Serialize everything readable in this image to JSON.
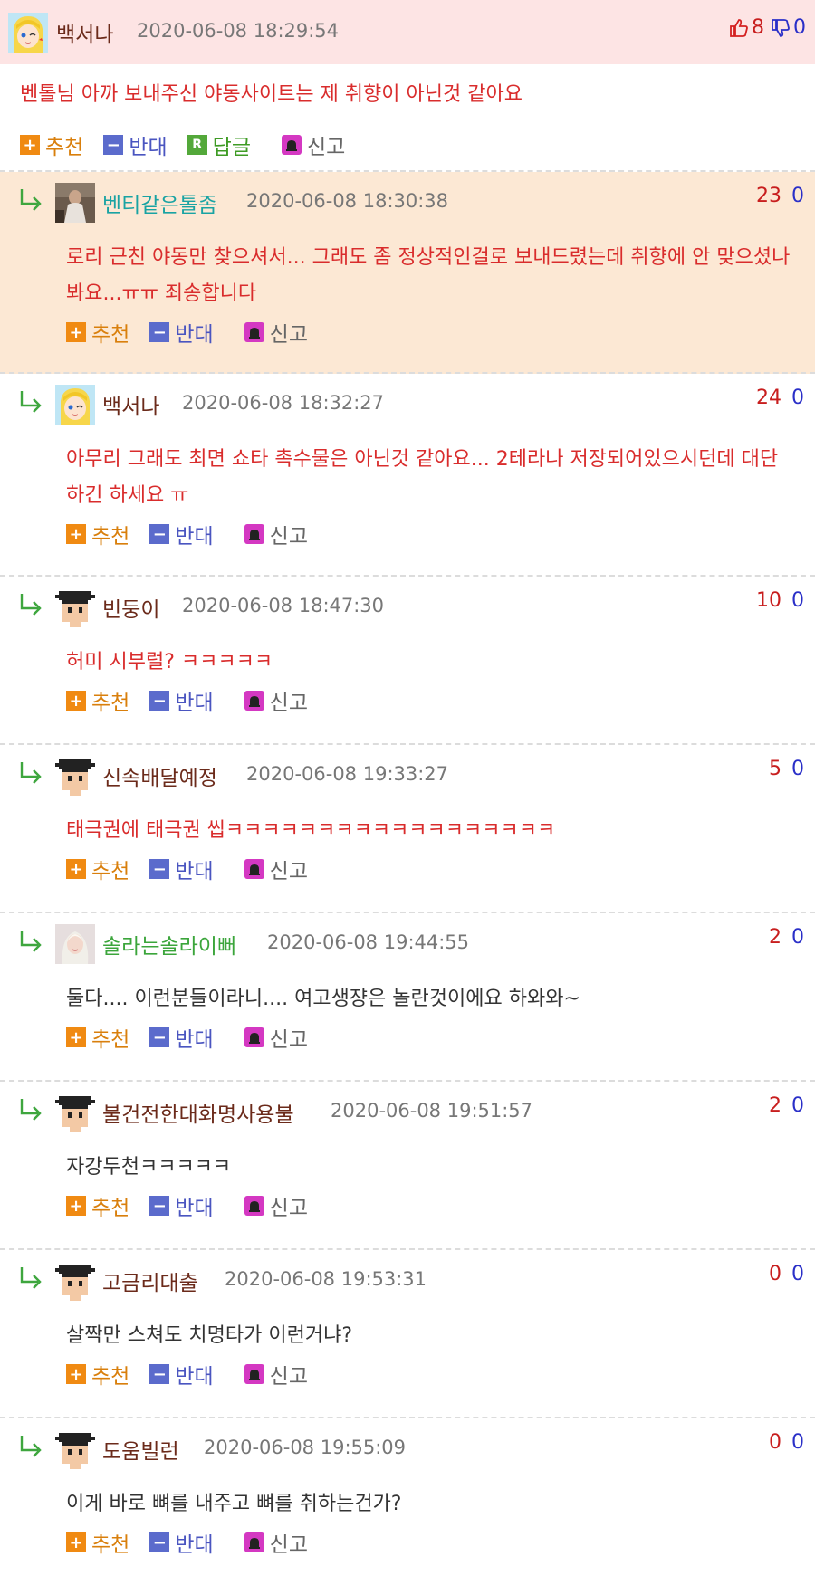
{
  "main": {
    "nick": "백서나",
    "date": "2020-06-08 18:29:54",
    "up": "8",
    "down": "0",
    "body": "벤톨님 아까 보내주신 야동사이트는 제 취향이 아닌것 같아요",
    "actions": {
      "rec": "추천",
      "opp": "반대",
      "reply": "답글",
      "report": "신고"
    }
  },
  "labels": {
    "rec": "추천",
    "opp": "반대",
    "report": "신고"
  },
  "comments": [
    {
      "nick": "벤티같은톨좀",
      "date": "2020-06-08 18:30:38",
      "up": "23",
      "down": "0",
      "body": "로리 근친 야동만 찾으셔서... 그래도 좀 정상적인걸로 보내드렸는데 취향에 안 맞으셨나봐요...ㅠㅠ 죄송합니다"
    },
    {
      "nick": "백서나",
      "date": "2020-06-08 18:32:27",
      "up": "24",
      "down": "0",
      "body": "아무리 그래도 최면 쇼타 촉수물은 아닌것 같아요... 2테라나 저장되어있으시던데 대단하긴 하세요 ㅠ"
    },
    {
      "nick": "빈둥이",
      "date": "2020-06-08 18:47:30",
      "up": "10",
      "down": "0",
      "body": "허미 시부럴? ㅋㅋㅋㅋㅋ"
    },
    {
      "nick": "신속배달예정",
      "date": "2020-06-08 19:33:27",
      "up": "5",
      "down": "0",
      "body": "태극권에 태극권 씹ㅋㅋㅋㅋㅋㅋㅋㅋㅋㅋㅋㅋㅋㅋㅋㅋㅋㅋ"
    },
    {
      "nick": "솔라는솔라이뻐",
      "date": "2020-06-08 19:44:55",
      "up": "2",
      "down": "0",
      "body": "둘다.... 이런분들이라니.... 여고생쟝은 놀란것이에요 하와와~"
    },
    {
      "nick": "불건전한대화명사용불",
      "date": "2020-06-08 19:51:57",
      "up": "2",
      "down": "0",
      "body": "자강두천ㅋㅋㅋㅋㅋ"
    },
    {
      "nick": "고금리대출",
      "date": "2020-06-08 19:53:31",
      "up": "0",
      "down": "0",
      "body": "살짝만 스쳐도 치명타가 이런거냐?"
    },
    {
      "nick": "도움빌런",
      "date": "2020-06-08 19:55:09",
      "up": "0",
      "down": "0",
      "body": "이게 바로 뼈를 내주고 뼈를 취하는건가?"
    }
  ]
}
